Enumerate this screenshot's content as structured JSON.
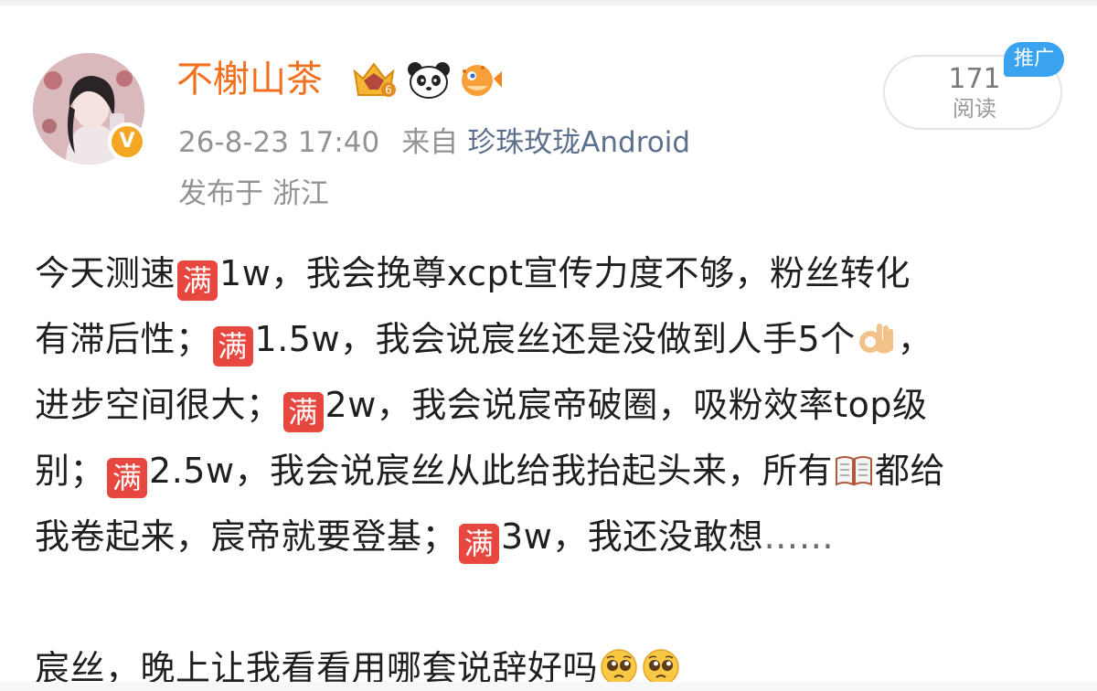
{
  "post": {
    "author": {
      "name": "不榭山茶",
      "avatar_icon": "avatar-portrait",
      "verified_icon": "orange-verified-v-icon",
      "verified_glyph": "V",
      "badges": [
        "crown-rank-6-badge-icon",
        "panda-icon",
        "pufferfish-icon"
      ],
      "crown_badge_number": "6"
    },
    "meta": {
      "datetime": "26-8-23 17:40",
      "from_label": "来自",
      "source": "珍珠玫珑Android",
      "location": "发布于 浙江"
    },
    "reads": {
      "count": "171",
      "label": "阅读",
      "promo_tag": "推广"
    },
    "full_emoji_glyph": "满",
    "lines": {
      "l1a": "今天测速",
      "l1b": "1w，我会挽尊xcpt宣传力度不够，粉丝转化",
      "l2a": "有滞后性；",
      "l2b": "1.5w，我会说宸丝还是没做到人手5个",
      "l2c": "，",
      "l3a": "进步空间很大；",
      "l3b": "2w，我会说宸帝破圈，吸粉效率top级",
      "l4a": "别；",
      "l4b": "2.5w，我会说宸丝从此给我抬起头来，所有",
      "l4c": "都给",
      "l5a": "我卷起来，宸帝就要登基；",
      "l5b": "3w，我还没敢想",
      "l5c": "……",
      "l7a": "宸丝，晚上让我看看用哪套说辞好吗"
    },
    "emoji_names": {
      "ok_hand": "ok-hand-icon",
      "book": "open-book-icon",
      "pleading": "pleading-face-icon"
    },
    "colors": {
      "username": "#f26f1f",
      "meta": "#939393",
      "source": "#5c6f8c",
      "body_text": "#1f1f1f",
      "full_emoji_bg": "#e8473f",
      "promo_bg": "#3aa3f0",
      "verified": "#f5a623"
    }
  }
}
